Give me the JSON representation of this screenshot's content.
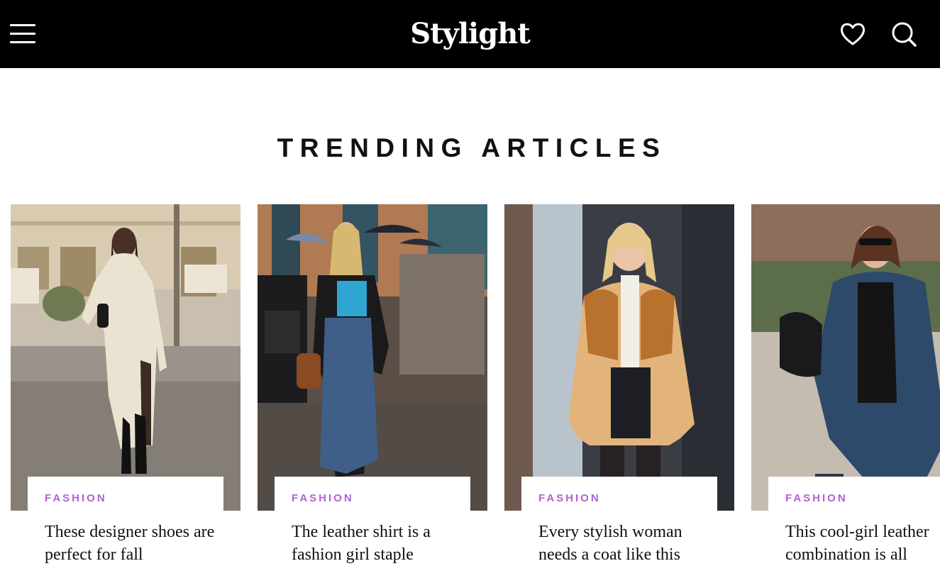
{
  "header": {
    "logo": "Stylight",
    "menu_icon": "hamburger-menu-icon",
    "wishlist_icon": "heart-icon",
    "search_icon": "search-icon",
    "background": "#000000"
  },
  "section": {
    "title": "TRENDING ARTICLES"
  },
  "articles": [
    {
      "category": "FASHION",
      "title": "These designer shoes are perfect for fall"
    },
    {
      "category": "FASHION",
      "title": "The leather shirt is a fashion girl staple"
    },
    {
      "category": "FASHION",
      "title": "Every stylish woman needs a coat like this"
    },
    {
      "category": "FASHION",
      "title": "This cool-girl leather combination is all"
    }
  ],
  "colors": {
    "accent": "#b45fd2",
    "text": "#111111"
  }
}
